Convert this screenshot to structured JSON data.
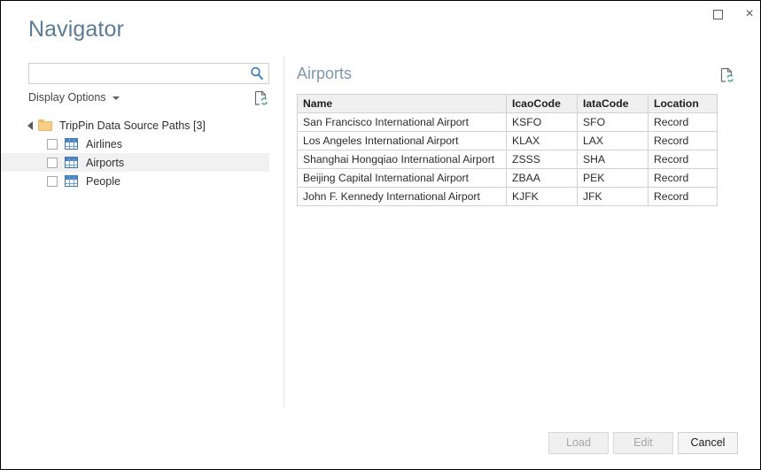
{
  "window": {
    "title": "Navigator",
    "controls": [
      {
        "name": "maximize-button",
        "glyph": "maximize-icon",
        "label": ""
      },
      {
        "name": "close-button",
        "glyph": "close-icon",
        "label": "×"
      }
    ]
  },
  "search": {
    "value": "",
    "placeholder": "",
    "icon": "search-icon"
  },
  "display_options": {
    "label": "Display Options",
    "caret": "chevron-down-icon"
  },
  "refresh": {
    "left_icon": "refresh-page-icon",
    "right_icon": "refresh-page-icon"
  },
  "tree": {
    "root": {
      "label": "TripPin Data Source Paths [3]",
      "icon": "folder-icon",
      "expanded": true
    },
    "items": [
      {
        "label": "Airlines",
        "icon": "table-icon",
        "checked": false,
        "selected": false
      },
      {
        "label": "Airports",
        "icon": "table-icon",
        "checked": false,
        "selected": true
      },
      {
        "label": "People",
        "icon": "table-icon",
        "checked": false,
        "selected": false
      }
    ]
  },
  "preview": {
    "title": "Airports",
    "columns": [
      "Name",
      "IcaoCode",
      "IataCode",
      "Location"
    ],
    "rows": [
      [
        "San Francisco International Airport",
        "KSFO",
        "SFO",
        "Record"
      ],
      [
        "Los Angeles International Airport",
        "KLAX",
        "LAX",
        "Record"
      ],
      [
        "Shanghai Hongqiao International Airport",
        "ZSSS",
        "SHA",
        "Record"
      ],
      [
        "Beijing Capital International Airport",
        "ZBAA",
        "PEK",
        "Record"
      ],
      [
        "John F. Kennedy International Airport",
        "KJFK",
        "JFK",
        "Record"
      ]
    ]
  },
  "footer": {
    "load": "Load",
    "edit": "Edit",
    "cancel": "Cancel"
  },
  "colors": {
    "title": "#5c7b96",
    "preview_title": "#7f97ab",
    "accent_blue": "#4a86c8",
    "folder_amber": "#f7cd87",
    "refresh_green": "#5aa88a",
    "header_bg": "#f0f0f0",
    "selection_bg": "#f1f1f1",
    "border": "#d2d2d2"
  }
}
